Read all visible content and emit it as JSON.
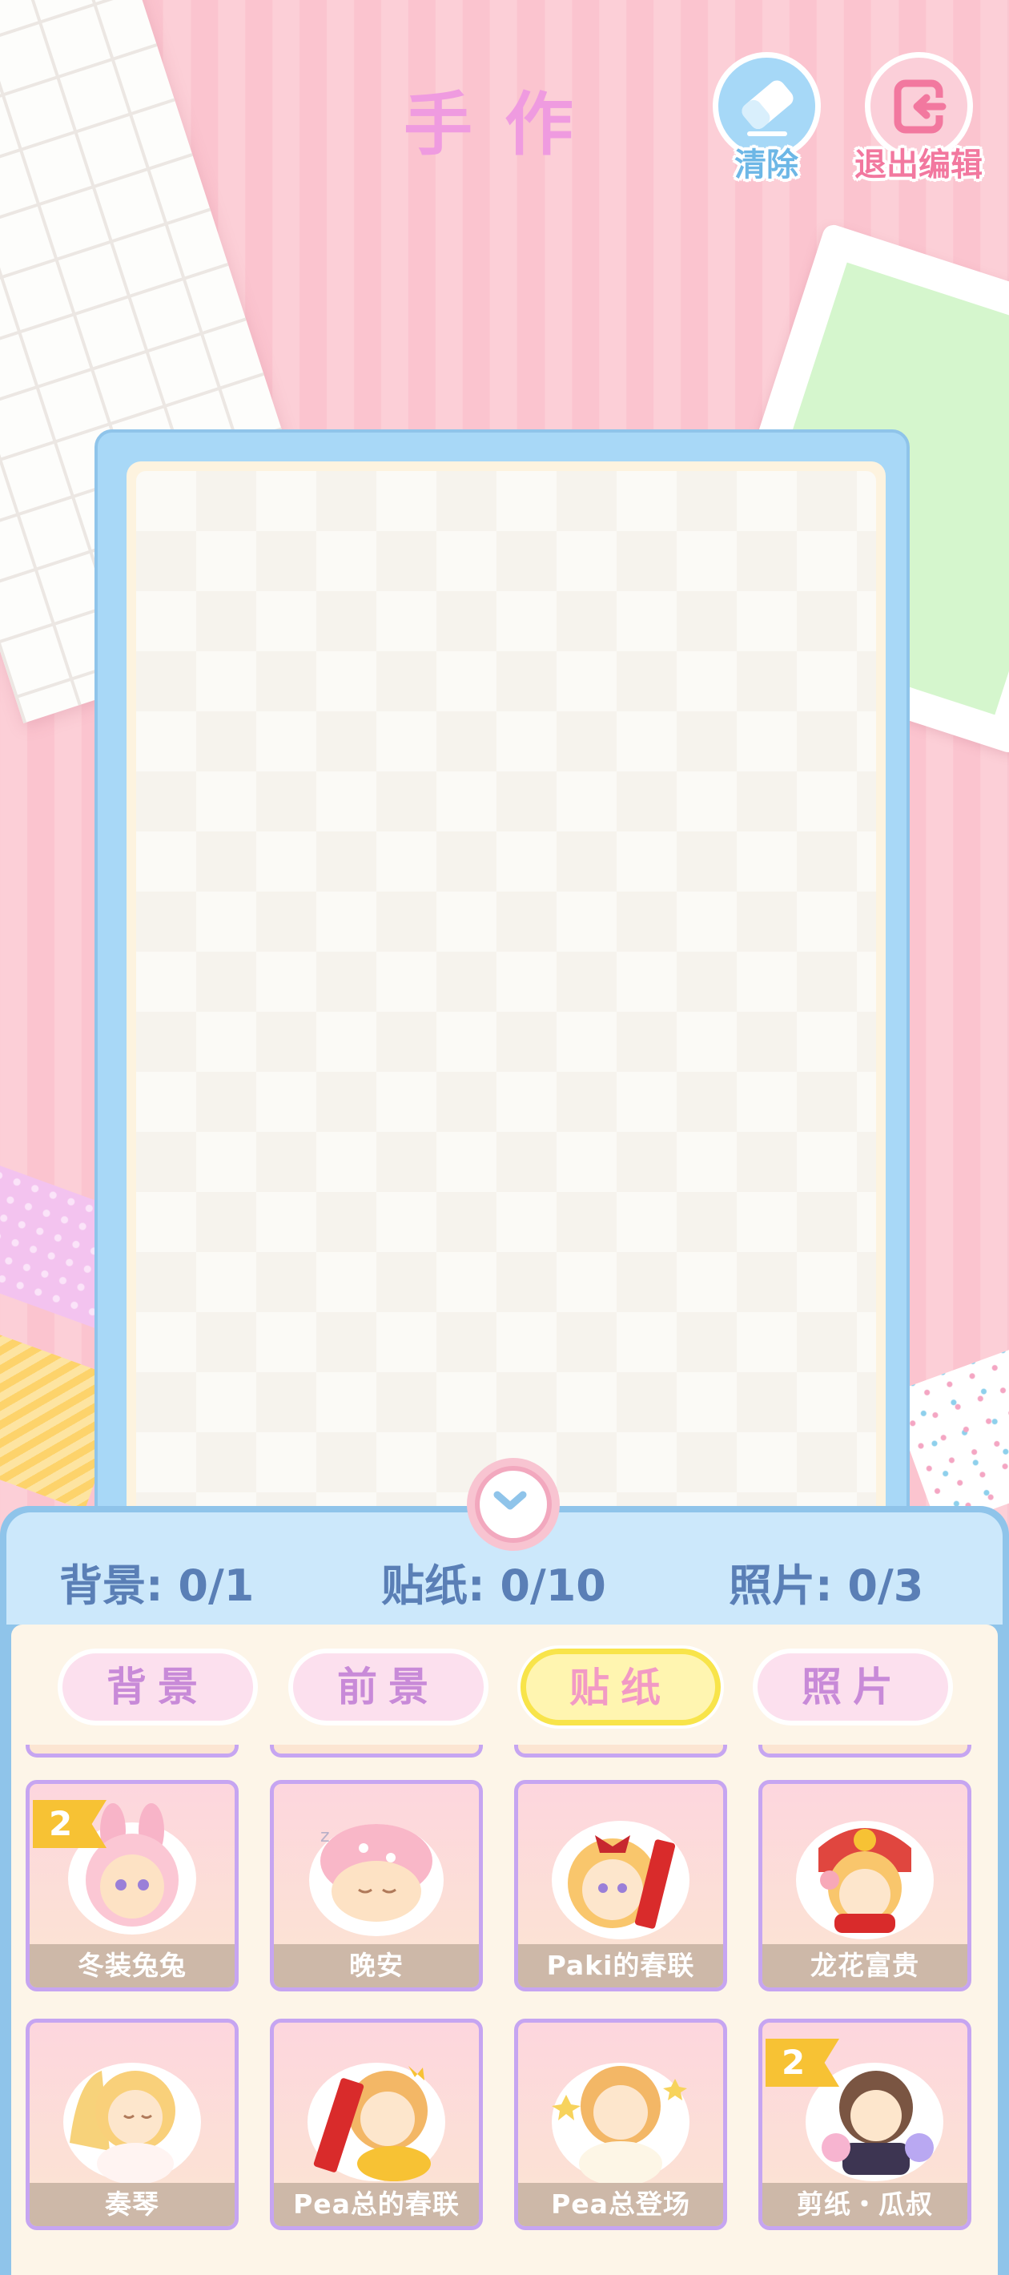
{
  "header": {
    "title": "手作",
    "clear_label": "清除",
    "exit_label": "退出编辑"
  },
  "counts": {
    "background": "背景: 0/1",
    "sticker": "贴纸: 0/10",
    "photo": "照片: 0/3"
  },
  "tabs": [
    {
      "label": "背景",
      "active": false
    },
    {
      "label": "前景",
      "active": false
    },
    {
      "label": "贴纸",
      "active": true
    },
    {
      "label": "照片",
      "active": false
    }
  ],
  "stickers": [
    {
      "name": "冬装兔兔",
      "badge": "2"
    },
    {
      "name": "晚安"
    },
    {
      "name": "Paki的春联"
    },
    {
      "name": "龙花富贵"
    },
    {
      "name": "奏琴"
    },
    {
      "name": "Pea总的春联"
    },
    {
      "name": "Pea总登场"
    },
    {
      "name": "剪纸・瓜叔",
      "badge": "2"
    }
  ],
  "colors": {
    "accent_pink": "#ef9be0",
    "clear_blue": "#a6d8f7",
    "exit_pink": "#fbcfd9",
    "count_text": "#5a7fb6",
    "card_border": "#c6a5f1",
    "badge": "#f7c234"
  },
  "icons": {
    "clear": "eraser-icon",
    "exit": "exit-icon",
    "collapse": "chevron-down-icon"
  }
}
